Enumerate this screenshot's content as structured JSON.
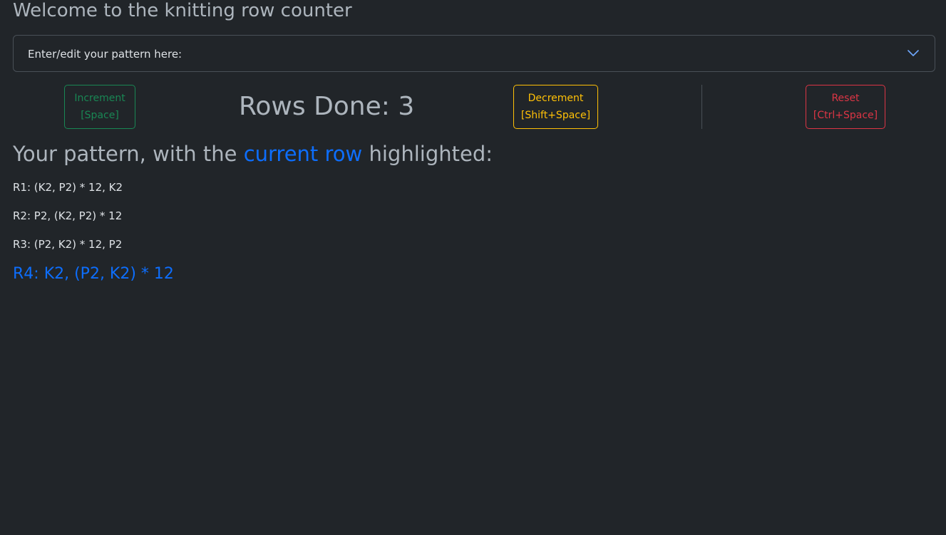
{
  "page": {
    "welcome_title": "Welcome to the knitting row counter"
  },
  "pattern_editor": {
    "label": "Enter/edit your pattern here:",
    "icon": "chevron-down-icon",
    "expanded": false
  },
  "controls": {
    "increment": {
      "label": "Increment",
      "shortcut": "[Space]",
      "color": "#198754"
    },
    "rows_done_label": "Rows Done: 3",
    "rows_done_value": 3,
    "decrement": {
      "label": "Decrement",
      "shortcut": "[Shift+Space]",
      "color": "#ffc107"
    },
    "reset": {
      "label": "Reset",
      "shortcut": "[Ctrl+Space]",
      "color": "#dc3545"
    }
  },
  "pattern_view": {
    "heading_before": "Your pattern, with the ",
    "heading_highlight": "current row",
    "heading_after": " highlighted:",
    "highlight_color": "#0d6efd",
    "rows": [
      {
        "text": "R1: (K2, P2) * 12, K2",
        "current": false
      },
      {
        "text": "R2: P2, (K2, P2) * 12",
        "current": false
      },
      {
        "text": "R3: (P2, K2) * 12, P2",
        "current": false
      },
      {
        "text": "R4: K2, (P2, K2) * 12",
        "current": true
      }
    ]
  }
}
